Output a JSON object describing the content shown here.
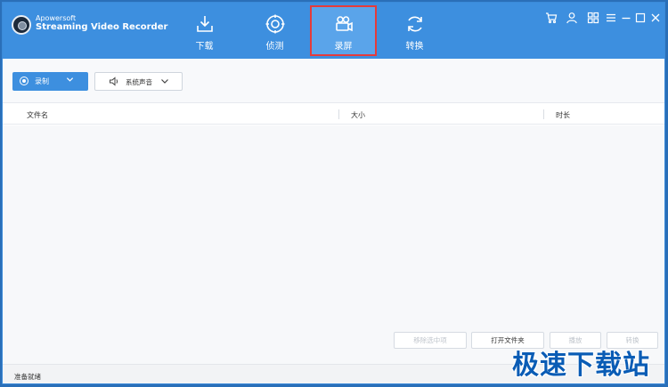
{
  "app": {
    "brand_line1": "Apowersoft",
    "brand_line2": "Streaming Video Recorder"
  },
  "nav": [
    {
      "label": "下载",
      "icon": "download-icon",
      "active": false
    },
    {
      "label": "侦测",
      "icon": "detect-icon",
      "active": false
    },
    {
      "label": "录屏",
      "icon": "camera-icon",
      "active": true
    },
    {
      "label": "转换",
      "icon": "convert-icon",
      "active": false
    }
  ],
  "window_controls": [
    "cart-icon",
    "user-icon",
    "grid-icon",
    "menu-icon",
    "minimize-icon",
    "maximize-icon",
    "close-icon"
  ],
  "toolbar": {
    "record_label": "录制",
    "audio_label": "系统声音"
  },
  "table": {
    "columns": [
      "文件名",
      "大小",
      "时长"
    ],
    "rows": []
  },
  "actions": {
    "remove_selected": "移除选中项",
    "open_folder": "打开文件夹",
    "play": "播放",
    "convert": "转换"
  },
  "status": {
    "text": "准备就绪"
  },
  "watermark": "极速下载站",
  "colors": {
    "header": "#3d8fdf",
    "active_tab": "#5aa4ea",
    "highlight_box": "#e53b3b",
    "watermark": "#0a5cb5"
  }
}
